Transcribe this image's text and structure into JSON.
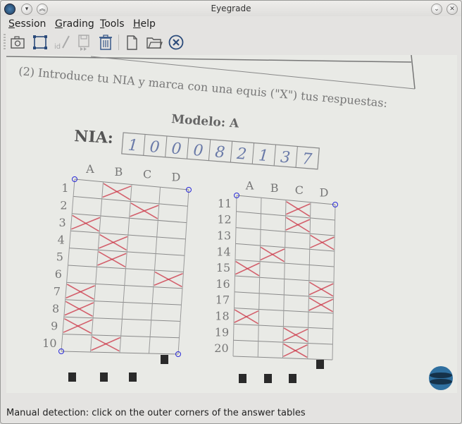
{
  "window": {
    "title": "Eyegrade"
  },
  "menu": {
    "items": [
      {
        "first": "S",
        "rest": "ession"
      },
      {
        "first": "G",
        "rest": "rading"
      },
      {
        "first": "T",
        "rest": "ools"
      },
      {
        "first": "H",
        "rest": "elp"
      }
    ]
  },
  "toolbar": {
    "id_label": "id"
  },
  "exam": {
    "instruction": "(2) Introduce tu NIA y marca con una equis (\"X\") tus respuestas:",
    "model": "Modelo: A",
    "nia_label": "NIA:",
    "nia_digits": [
      "1",
      "0",
      "0",
      "0",
      "8",
      "2",
      "1",
      "3",
      "7"
    ],
    "columns": [
      "A",
      "B",
      "C",
      "D"
    ],
    "rows_left": [
      "1",
      "2",
      "3",
      "4",
      "5",
      "6",
      "7",
      "8",
      "9",
      "10"
    ],
    "rows_right": [
      "11",
      "12",
      "13",
      "14",
      "15",
      "16",
      "17",
      "18",
      "19",
      "20"
    ],
    "answers_left": [
      "B",
      "C",
      "A",
      "B",
      "B",
      "D",
      "A",
      "A",
      "A",
      "B"
    ],
    "answers_right": [
      "C",
      "C",
      "D",
      "B",
      "A",
      "D",
      "D",
      "A",
      "C",
      "C"
    ]
  },
  "status": {
    "message": "Manual detection: click on the outer corners of the answer tables"
  },
  "colors": {
    "marks": "#cc3344",
    "corner_points": "#2a2ad8"
  }
}
